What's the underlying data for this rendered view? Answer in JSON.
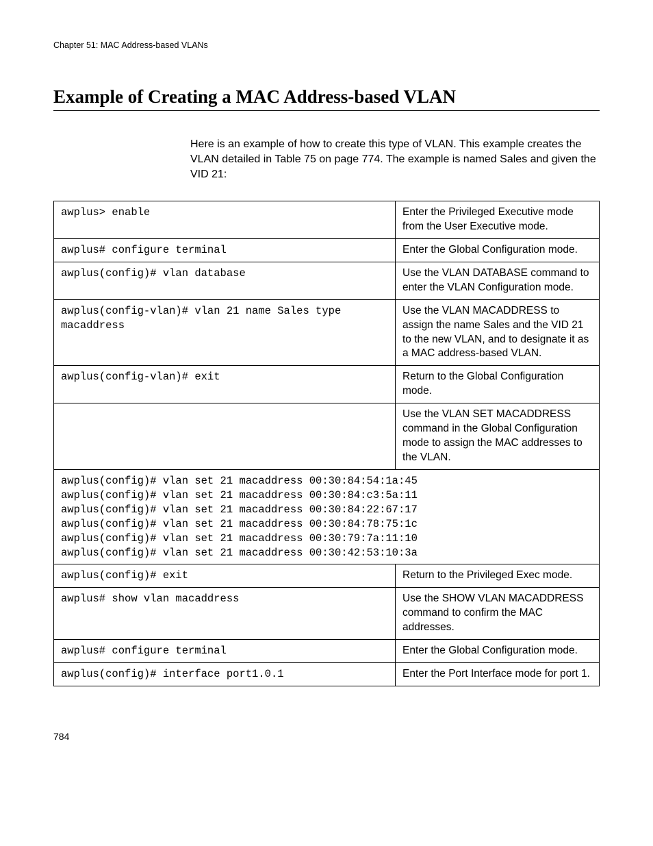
{
  "chapter": "Chapter 51: MAC Address-based VLANs",
  "title": "Example of Creating a MAC Address-based VLAN",
  "intro": "Here is an example of how to create this type of VLAN. This example creates the VLAN detailed in Table 75 on page 774. The example is named Sales and given the VID 21:",
  "rows": [
    {
      "cmd": "awplus> enable",
      "desc": "Enter the Privileged Executive mode from the User Executive mode."
    },
    {
      "cmd": "awplus# configure terminal",
      "desc": "Enter the Global Configuration mode."
    },
    {
      "cmd": "awplus(config)# vlan database",
      "desc": "Use the VLAN DATABASE command to enter the VLAN Configuration mode."
    },
    {
      "cmd": "awplus(config-vlan)# vlan 21 name Sales type macaddress",
      "desc": "Use the VLAN MACADDRESS to assign the name Sales and the VID 21 to the new VLAN, and to designate it as a MAC address-based VLAN."
    },
    {
      "cmd": "awplus(config-vlan)# exit",
      "desc": "Return to the Global Configuration mode."
    },
    {
      "cmd": "",
      "desc": "Use the VLAN SET MACADDRESS command in the Global Configuration mode to assign the MAC addresses to the VLAN."
    }
  ],
  "macblock": "awplus(config)# vlan set 21 macaddress 00:30:84:54:1a:45\nawplus(config)# vlan set 21 macaddress 00:30:84:c3:5a:11\nawplus(config)# vlan set 21 macaddress 00:30:84:22:67:17\nawplus(config)# vlan set 21 macaddress 00:30:84:78:75:1c\nawplus(config)# vlan set 21 macaddress 00:30:79:7a:11:10\nawplus(config)# vlan set 21 macaddress 00:30:42:53:10:3a",
  "rows2": [
    {
      "cmd": "awplus(config)# exit",
      "desc": "Return to the Privileged Exec mode."
    },
    {
      "cmd": "awplus# show vlan macaddress",
      "desc": "Use the SHOW VLAN MACADDRESS command to confirm the MAC addresses."
    },
    {
      "cmd": "awplus# configure terminal",
      "desc": "Enter the Global Configuration mode."
    },
    {
      "cmd": "awplus(config)# interface port1.0.1",
      "desc": "Enter the Port Interface mode for port 1."
    }
  ],
  "pagenum": "784"
}
